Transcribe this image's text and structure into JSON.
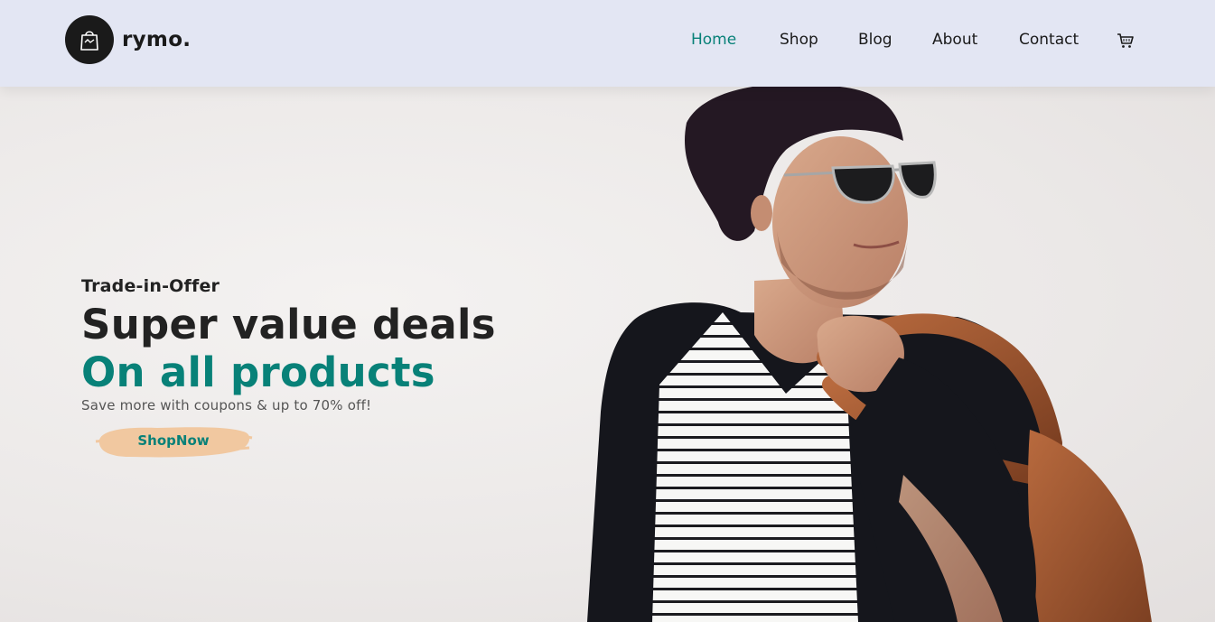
{
  "brand": {
    "name": "rymo.",
    "icon": "shopping-bag-icon"
  },
  "nav": {
    "items": [
      {
        "label": "Home",
        "active": true
      },
      {
        "label": "Shop",
        "active": false
      },
      {
        "label": "Blog",
        "active": false
      },
      {
        "label": "About",
        "active": false
      },
      {
        "label": "Contact",
        "active": false
      }
    ],
    "cart_icon": "cart-icon"
  },
  "hero": {
    "tag": "Trade-in-Offer",
    "headline": "Super value deals",
    "headline_accent": "On all products",
    "subtext": "Save more with coupons & up to 70% off!",
    "cta_label": "ShopNow"
  },
  "colors": {
    "accent": "#088178",
    "header_bg": "#e3e6f3",
    "text_dark": "#222222",
    "button_brush": "#f1c8a0"
  }
}
